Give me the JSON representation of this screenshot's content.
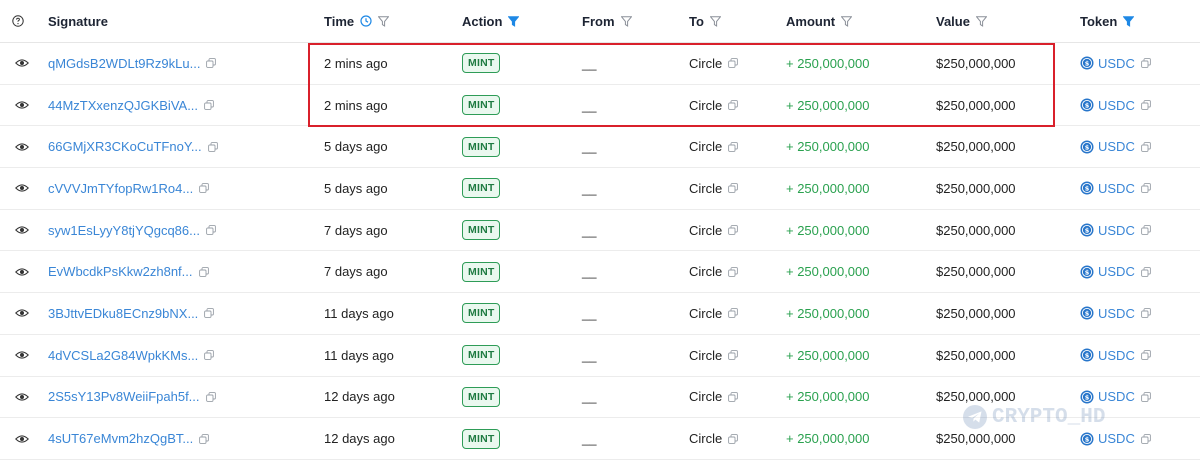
{
  "header": {
    "signature": "Signature",
    "time": "Time",
    "action": "Action",
    "from": "From",
    "to": "To",
    "amount": "Amount",
    "value": "Value",
    "token": "Token",
    "active_filter_color": "#1e88e5",
    "inactive_filter_color": "#8a8f98"
  },
  "rows": [
    {
      "signature": "qMGdsB2WDLt9Rz9kLu...",
      "time": "2 mins ago",
      "action": "MINT",
      "from": "__",
      "to": "Circle",
      "amount": "+ 250,000,000",
      "value": "$250,000,000",
      "token": "USDC"
    },
    {
      "signature": "44MzTXxenzQJGKBiVA...",
      "time": "2 mins ago",
      "action": "MINT",
      "from": "__",
      "to": "Circle",
      "amount": "+ 250,000,000",
      "value": "$250,000,000",
      "token": "USDC"
    },
    {
      "signature": "66GMjXR3CKoCuTFnoY...",
      "time": "5 days ago",
      "action": "MINT",
      "from": "__",
      "to": "Circle",
      "amount": "+ 250,000,000",
      "value": "$250,000,000",
      "token": "USDC"
    },
    {
      "signature": "cVVVJmTYfopRw1Ro4...",
      "time": "5 days ago",
      "action": "MINT",
      "from": "__",
      "to": "Circle",
      "amount": "+ 250,000,000",
      "value": "$250,000,000",
      "token": "USDC"
    },
    {
      "signature": "syw1EsLyyY8tjYQgcq86...",
      "time": "7 days ago",
      "action": "MINT",
      "from": "__",
      "to": "Circle",
      "amount": "+ 250,000,000",
      "value": "$250,000,000",
      "token": "USDC"
    },
    {
      "signature": "EvWbcdkPsKkw2zh8nf...",
      "time": "7 days ago",
      "action": "MINT",
      "from": "__",
      "to": "Circle",
      "amount": "+ 250,000,000",
      "value": "$250,000,000",
      "token": "USDC"
    },
    {
      "signature": "3BJttvEDku8ECnz9bNX...",
      "time": "11 days ago",
      "action": "MINT",
      "from": "__",
      "to": "Circle",
      "amount": "+ 250,000,000",
      "value": "$250,000,000",
      "token": "USDC"
    },
    {
      "signature": "4dVCSLa2G84WpkKMs...",
      "time": "11 days ago",
      "action": "MINT",
      "from": "__",
      "to": "Circle",
      "amount": "+ 250,000,000",
      "value": "$250,000,000",
      "token": "USDC"
    },
    {
      "signature": "2S5sY13Pv8WeiiFpah5f...",
      "time": "12 days ago",
      "action": "MINT",
      "from": "__",
      "to": "Circle",
      "amount": "+ 250,000,000",
      "value": "$250,000,000",
      "token": "USDC"
    },
    {
      "signature": "4sUT67eMvm2hzQgBT...",
      "time": "12 days ago",
      "action": "MINT",
      "from": "__",
      "to": "Circle",
      "amount": "+ 250,000,000",
      "value": "$250,000,000",
      "token": "USDC"
    }
  ],
  "highlight": {
    "color": "#d9202b"
  },
  "watermark": {
    "text": "CRYPTO_HD"
  }
}
